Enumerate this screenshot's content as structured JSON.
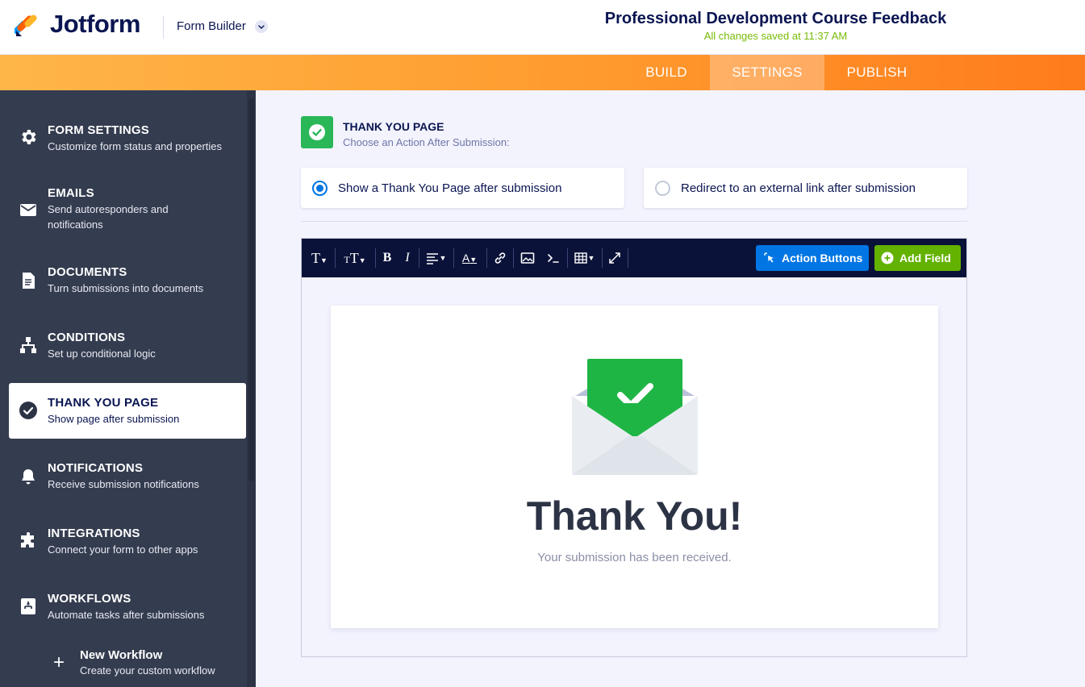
{
  "header": {
    "brand": "Jotform",
    "builder_menu": "Form Builder",
    "form_title": "Professional Development Course Feedback",
    "save_status": "All changes saved at 11:37 AM"
  },
  "tabs": {
    "build": "BUILD",
    "settings": "SETTINGS",
    "publish": "PUBLISH",
    "active": "SETTINGS"
  },
  "sidebar": {
    "items": [
      {
        "title": "FORM SETTINGS",
        "desc": "Customize form status and properties",
        "icon": "gear-icon"
      },
      {
        "title": "EMAILS",
        "desc": "Send autoresponders and notifications",
        "icon": "envelope-icon"
      },
      {
        "title": "DOCUMENTS",
        "desc": "Turn submissions into documents",
        "icon": "document-icon"
      },
      {
        "title": "CONDITIONS",
        "desc": "Set up conditional logic",
        "icon": "conditions-icon"
      },
      {
        "title": "THANK YOU PAGE",
        "desc": "Show page after submission",
        "icon": "check-circle-icon",
        "active": true
      },
      {
        "title": "NOTIFICATIONS",
        "desc": "Receive submission notifications",
        "icon": "bell-icon"
      },
      {
        "title": "INTEGRATIONS",
        "desc": "Connect your form to other apps",
        "icon": "puzzle-icon"
      },
      {
        "title": "WORKFLOWS",
        "desc": "Automate tasks after submissions",
        "icon": "workflow-icon"
      }
    ],
    "new_workflow": {
      "title": "New Workflow",
      "desc": "Create your custom workflow"
    }
  },
  "section": {
    "title": "THANK YOU PAGE",
    "subtitle": "Choose an Action After Submission:"
  },
  "options": [
    {
      "label": "Show a Thank You Page after submission",
      "selected": true
    },
    {
      "label": "Redirect to an external link after submission",
      "selected": false
    }
  ],
  "editor": {
    "toolbar": {
      "text_size": "T",
      "text_case": "T",
      "bold": "B",
      "italic": "I",
      "font_color": "A"
    },
    "action_buttons_label": "Action Buttons",
    "add_field_label": "Add Field"
  },
  "preview": {
    "heading": "Thank You!",
    "message": "Your submission has been received."
  },
  "colors": {
    "accent_blue": "#0075e3",
    "success_green": "#2ab758",
    "add_field_green": "#64b200",
    "sidebar_bg": "#343c4f",
    "orange": "#ff9a2e"
  }
}
